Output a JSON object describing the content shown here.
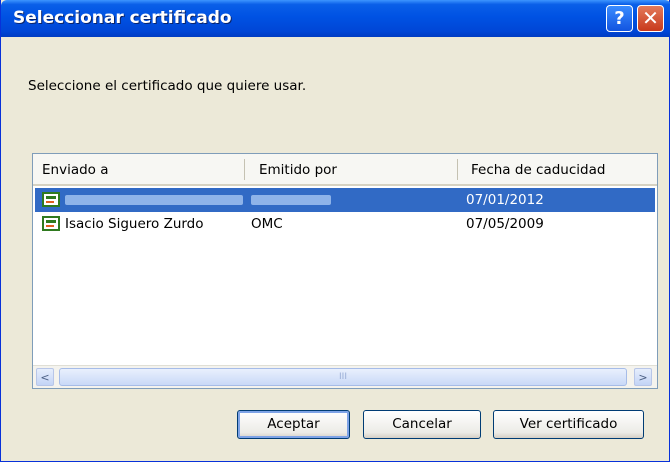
{
  "window": {
    "title": "Seleccionar certificado",
    "help_glyph": "?",
    "close_glyph": "✕"
  },
  "prompt": "Seleccione el certificado que quiere usar.",
  "table": {
    "columns": [
      "Enviado a",
      "Emitido por",
      "Fecha de caducidad"
    ],
    "rows": [
      {
        "sent_to": "",
        "issued_by": "",
        "expiry": "07/01/2012",
        "selected": true
      },
      {
        "sent_to": "Isacio Siguero Zurdo",
        "issued_by": "OMC",
        "expiry": "07/05/2009",
        "selected": false
      }
    ]
  },
  "scrollbar": {
    "left": "<",
    "right": ">",
    "grip": "III"
  },
  "buttons": {
    "accept": "Aceptar",
    "cancel": "Cancelar",
    "view": "Ver certificado"
  },
  "colors": {
    "titlebar": "#0052e3",
    "selection": "#316ac5",
    "dialog_bg": "#ece9d8"
  }
}
